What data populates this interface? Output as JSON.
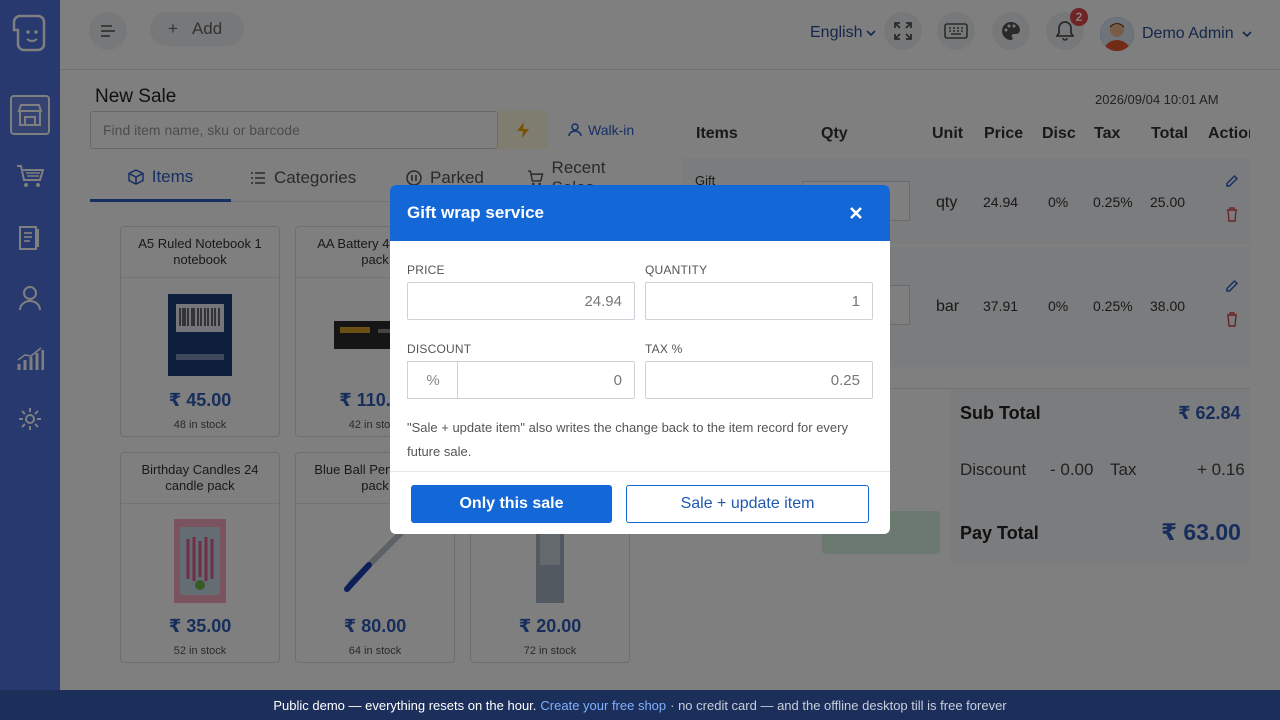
{
  "header": {
    "add_label": "Add",
    "language": "English",
    "notification_count": "2",
    "user_name": "Demo Admin"
  },
  "sale": {
    "title": "New  Sale",
    "datetime": "2026/09/04 10:01 AM",
    "search_placeholder": "Find item name, sku or barcode",
    "customer": "Walk-in"
  },
  "tabs": [
    {
      "label": "Items"
    },
    {
      "label": "Categories"
    },
    {
      "label": "Parked"
    },
    {
      "label": "Recent Sales"
    }
  ],
  "products": [
    {
      "name": "A5 Ruled Notebook 1 notebook",
      "price": "₹ 45.00",
      "stock": "48 in stock"
    },
    {
      "name": "AA Battery 4 battery pack",
      "price": "₹ 110.00",
      "stock": "42 in stock"
    },
    {
      "name": "Birthday Candles 24 candle pack",
      "price": "₹ 35.00",
      "stock": "52 in stock"
    },
    {
      "name": "Blue Ball Pen 10 pen pack",
      "price": "₹ 80.00",
      "stock": "64 in stock"
    },
    {
      "name": "",
      "price": "₹ 20.00",
      "stock": "72 in stock"
    }
  ],
  "cart": {
    "columns": [
      "Items",
      "Qty",
      "Unit",
      "Price",
      "Disc",
      "Tax",
      "Total",
      "Action"
    ],
    "rows": [
      {
        "item": "Gift",
        "unit": "qty",
        "price": "24.94",
        "disc": "0%",
        "tax": "0.25%",
        "total": "25.00"
      },
      {
        "item": "",
        "unit": "bar",
        "price": "37.91",
        "disc": "0%",
        "tax": "0.25%",
        "total": "38.00"
      }
    ],
    "sub_total_label": "Sub Total",
    "sub_total": "₹ 62.84",
    "discount_label": "Discount",
    "discount": "- 0.00",
    "tax_label": "Tax",
    "tax": "+ 0.16",
    "pay_total_label": "Pay Total",
    "pay_total": "₹ 63.00"
  },
  "modal": {
    "title": "Gift wrap service",
    "price_label": "PRICE",
    "price": "24.94",
    "quantity_label": "QUANTITY",
    "quantity": "1",
    "discount_label": "DISCOUNT",
    "discount_type": "%",
    "discount": "0",
    "tax_label": "TAX %",
    "tax": "0.25",
    "note": "\"Sale + update item\" also writes the change back to the item record for every future sale.",
    "btn_only_sale": "Only this sale",
    "btn_update_item": "Sale + update item"
  },
  "banner": {
    "text1": "Public demo — everything resets on the hour.",
    "link": "Create your free shop",
    "text2": "· no credit card — and the offline desktop till is free forever"
  },
  "colors": {
    "sidebar": "#4e73df",
    "primary": "#1367d6",
    "price_blue": "#2e5cb8",
    "banner": "#1c2e5a"
  }
}
